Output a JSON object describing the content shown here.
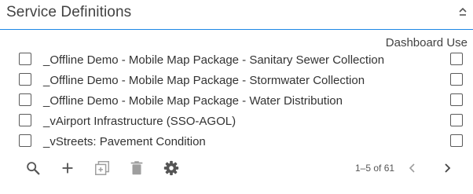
{
  "panel": {
    "title": "Service Definitions",
    "collapse_icon": "chevron-up-icon"
  },
  "list": {
    "column_header": "Dashboard Use",
    "items": [
      {
        "label": "_Offline Demo - Mobile Map Package - Sanitary Sewer Collection",
        "selected": false,
        "dashboard_use": false
      },
      {
        "label": "_Offline Demo - Mobile Map Package - Stormwater Collection",
        "selected": false,
        "dashboard_use": false
      },
      {
        "label": "_Offline Demo - Mobile Map Package - Water Distribution",
        "selected": false,
        "dashboard_use": false
      },
      {
        "label": "_vAirport Infrastructure (SSO-AGOL)",
        "selected": false,
        "dashboard_use": false
      },
      {
        "label": "_vStreets: Pavement Condition",
        "selected": false,
        "dashboard_use": false
      }
    ]
  },
  "toolbar": {
    "icons": [
      "search-icon",
      "add-icon",
      "copy-icon",
      "delete-icon",
      "settings-icon"
    ],
    "pagination_text": "1–5 of 61",
    "prev_icon": "chevron-left-icon",
    "next_icon": "chevron-right-icon"
  },
  "colors": {
    "accent": "#1e88e5",
    "icon": "#555555",
    "icon_disabled": "#9e9e9e",
    "text": "#333333"
  }
}
